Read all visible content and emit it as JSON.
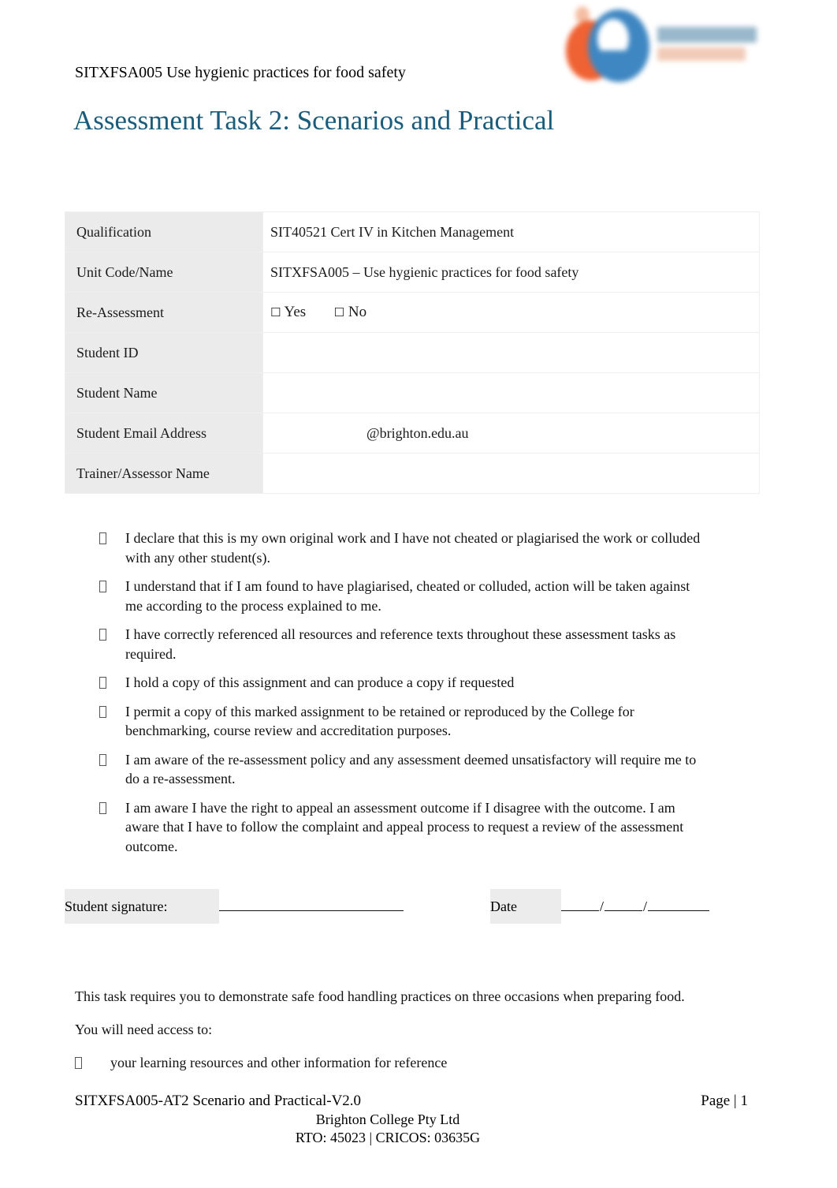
{
  "header": {
    "unit_line": "SITXFSA005 Use hygienic practices for food safety",
    "title": "Assessment Task 2: Scenarios and Practical",
    "logo": {
      "name": "brighton-college-logo",
      "alt_text": "Brighton College",
      "orange": "#ee5522",
      "blue": "#2f7dbd"
    }
  },
  "details_table": {
    "rows": [
      {
        "label": "Qualification",
        "value": "SIT40521 Cert IV in Kitchen Management",
        "type": "text"
      },
      {
        "label": "Unit Code/Name",
        "value": "SITXFSA005 – Use hygienic practices for food safety",
        "type": "text"
      },
      {
        "label": "Re-Assessment",
        "value": "",
        "type": "checkbox",
        "options": [
          "Yes",
          "No"
        ],
        "checkbox_glyph": "☐"
      },
      {
        "label": "Student ID",
        "value": "",
        "type": "text"
      },
      {
        "label": "Student Name",
        "value": "",
        "type": "text"
      },
      {
        "label": "Student Email Address",
        "value": "@brighton.edu.au",
        "type": "email"
      },
      {
        "label": "Trainer/Assessor Name",
        "value": "",
        "type": "text"
      }
    ]
  },
  "declaration": {
    "items": [
      "I declare that this is my own original work and I have not cheated or plagiarised the work or colluded with any other student(s).",
      "I understand that if I am found to have plagiarised, cheated or colluded, action will be taken against me according to the process explained to me.",
      "I have correctly referenced all resources and reference texts throughout these assessment tasks as required.",
      "I hold a copy of this assignment and can produce a copy if requested",
      "I permit a copy of this marked assignment to be retained or reproduced by the College for benchmarking, course review and accreditation purposes.",
      "I am aware of the re-assessment policy and any assessment deemed unsatisfactory will require me to do a re-assessment.",
      "I am aware I have the right to appeal an assessment outcome if I disagree with the outcome. I am aware that I have to follow the complaint and appeal process to request a review of the assessment outcome."
    ]
  },
  "signature_row": {
    "signature_label": "Student signature:",
    "date_label": "Date",
    "date_separator": "/"
  },
  "body": {
    "paragraph_1": "This task requires you to demonstrate safe food handling practices on three occasions when preparing food.",
    "paragraph_2": "You will need access to:",
    "access_items": [
      "your learning resources and other information for reference"
    ]
  },
  "footer": {
    "doc_ref": "SITXFSA005-AT2 Scenario and Practical-V2.0",
    "page_number": "Page | 1",
    "company": "Brighton College Pty Ltd",
    "registration": "RTO: 45023 | CRICOS: 03635G"
  }
}
